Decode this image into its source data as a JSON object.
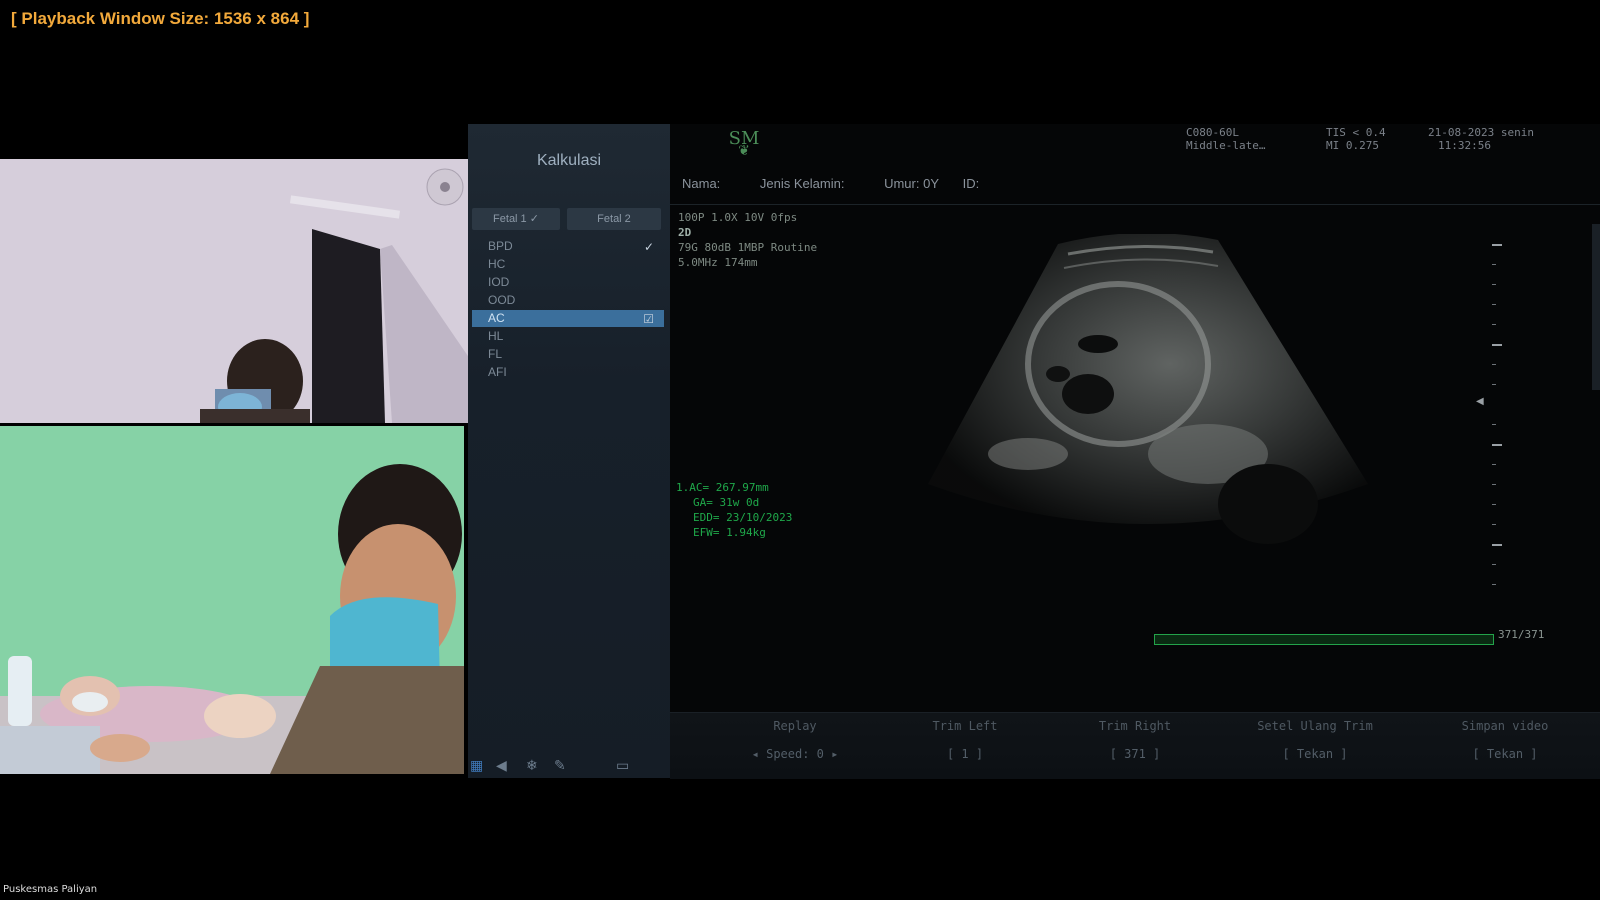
{
  "window": {
    "playback_label": "[ Playback Window Size: 1536 x 864 ]"
  },
  "ultrasound": {
    "logo": {
      "text": "SM"
    },
    "calc_panel": {
      "title": "Kalkulasi",
      "tabs": [
        {
          "label": "Fetal 1 ✓"
        },
        {
          "label": "Fetal 2"
        }
      ],
      "items": [
        {
          "label": "BPD",
          "checked": true
        },
        {
          "label": "HC",
          "checked": false
        },
        {
          "label": "IOD",
          "checked": false
        },
        {
          "label": "OOD",
          "checked": false
        },
        {
          "label": "AC",
          "checked": true,
          "selected": true
        },
        {
          "label": "HL",
          "checked": false
        },
        {
          "label": "FL",
          "checked": false
        },
        {
          "label": "AFI",
          "checked": false
        }
      ]
    },
    "header": {
      "probe": "C080-60L",
      "preset": "Middle-late…",
      "tis": "TIS < 0.4",
      "mi": "MI 0.275",
      "date": "21-08-2023 senin",
      "time": "11:32:56"
    },
    "patient": {
      "name_label": "Nama:",
      "gender_label": "Jenis Kelamin:",
      "age_label": "Umur: 0Y",
      "id_label": "ID:"
    },
    "params": {
      "line1": "100P 1.0X 10V   0fps",
      "mode": "2D",
      "line2": "79G 80dB 1MBP Routine",
      "line3": "5.0MHz 174mm"
    },
    "calc_results": {
      "ac": "1.AC= 267.97mm",
      "ga": "GA= 31w 0d",
      "edd": "EDD= 23/10/2023",
      "efw": "EFW= 1.94kg"
    },
    "cine": {
      "count": "371/371",
      "progress": 1.0
    },
    "toolbar": {
      "replay": {
        "label": "Replay",
        "value": "◂  Speed: 0  ▸"
      },
      "trim_left": {
        "label": "Trim Left",
        "value": "[  1  ]"
      },
      "trim_right": {
        "label": "Trim Right",
        "value": "[  371  ]"
      },
      "reset_trim": {
        "label": "Setel Ulang Trim",
        "value": "[  Tekan  ]"
      },
      "save_video": {
        "label": "Simpan video",
        "value": "[  Tekan  ]"
      }
    }
  },
  "caption": "Puskesmas Paliyan",
  "colors": {
    "playback_label": "#f2a93b",
    "calc_result": "#1fa84a",
    "selected_item": "#3b6f9c"
  }
}
